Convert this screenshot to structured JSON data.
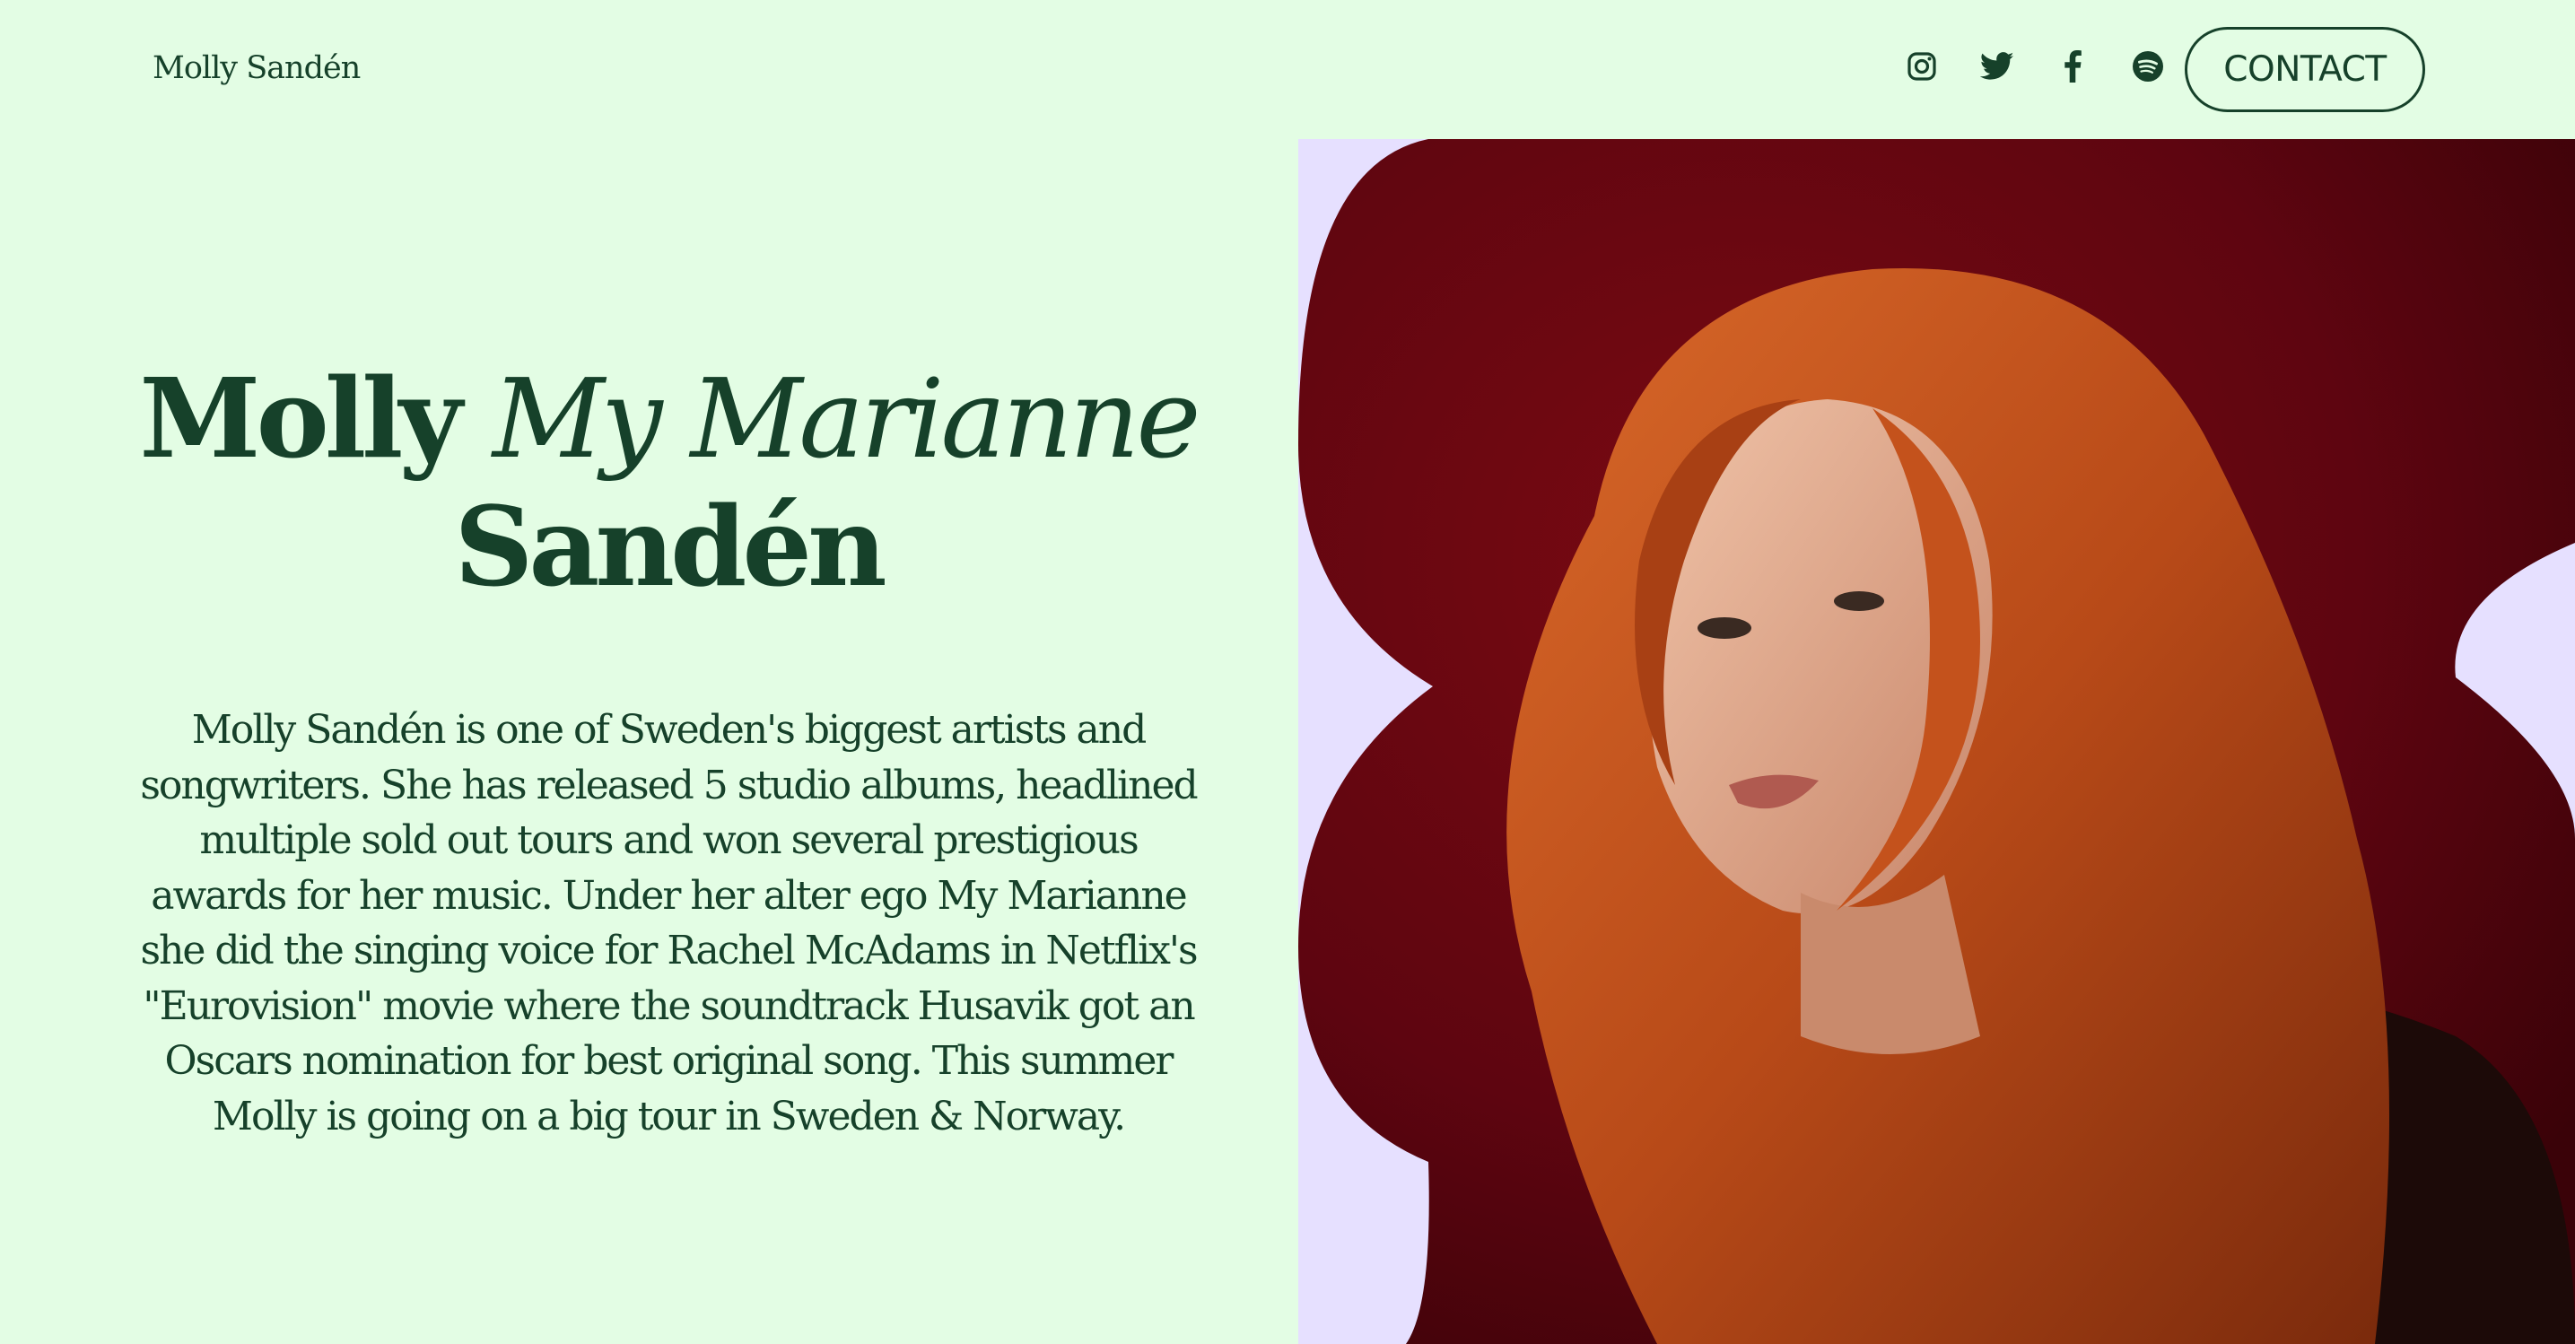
{
  "header": {
    "brand": "Molly Sandén",
    "socials": [
      {
        "name": "instagram",
        "icon": "instagram-icon"
      },
      {
        "name": "twitter",
        "icon": "twitter-icon"
      },
      {
        "name": "facebook",
        "icon": "facebook-icon"
      },
      {
        "name": "spotify",
        "icon": "spotify-icon"
      }
    ],
    "contact_label": "CONTACT"
  },
  "hero": {
    "title_first": "Molly",
    "title_alias": "My Marianne",
    "title_last": "Sandén",
    "bio": "Molly Sandén is one of Sweden's biggest artists and songwriters. She has released 5 studio albums, headlined multiple sold out tours and won several prestigious awards for her music. Under her alter ego My Marianne she did the singing voice for Rachel McAdams in Netflix's \"Eurovision\" movie where the soundtrack Husavik got an Oscars nomination for best original song. This summer Molly is going on a big tour in Sweden & Norway."
  },
  "colors": {
    "background": "#e3fde4",
    "text": "#16412a",
    "photo_panel": "#e6e0ff",
    "photo_backdrop": "#6a0610",
    "hair": "#c4521c"
  }
}
